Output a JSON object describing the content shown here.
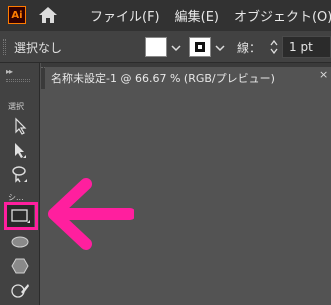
{
  "menubar": {
    "logo": "Ai",
    "items": [
      "ファイル(F)",
      "編集(E)",
      "オブジェクト(O)"
    ]
  },
  "controlbar": {
    "selection": "選択なし",
    "stroke_label": "線：",
    "stroke_value": "1 pt"
  },
  "toolbar": {
    "collapse": "▸▸",
    "section_select": "選択",
    "section_shape": "シ..."
  },
  "document": {
    "tab_title": "名称未設定-1 @ 66.67 % (RGB/プレビュー)",
    "close": "×"
  },
  "colors": {
    "accent_highlight": "#ff1f9e",
    "logo_orange": "#ff7c00"
  },
  "icons": [
    "illustrator-logo-icon",
    "home-icon",
    "chevron-down-icon",
    "stepper-icon",
    "selection-tool-icon",
    "direct-selection-tool-icon",
    "lasso-tool-icon",
    "rectangle-tool-icon",
    "ellipse-tool-icon",
    "polygon-tool-icon",
    "shaper-tool-icon",
    "arrow-annotation-icon"
  ]
}
